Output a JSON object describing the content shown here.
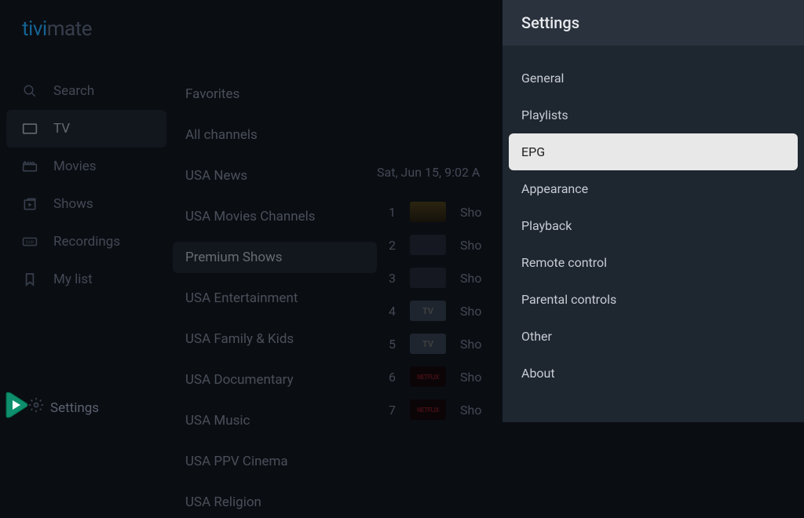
{
  "logo": {
    "brand1": "tivi",
    "brand2": "mate"
  },
  "sidebar": {
    "items": [
      {
        "label": "Search"
      },
      {
        "label": "TV"
      },
      {
        "label": "Movies"
      },
      {
        "label": "Shows"
      },
      {
        "label": "Recordings"
      },
      {
        "label": "My list"
      }
    ],
    "settings_label": "Settings"
  },
  "categories": [
    "Favorites",
    "All channels",
    "USA News",
    "USA Movies Channels",
    "Premium Shows",
    "USA Entertainment",
    "USA Family & Kids",
    "USA Documentary",
    "USA Music",
    "USA PPV Cinema",
    "USA Religion"
  ],
  "schedule": {
    "date": "Sat, Jun 15, 9:02 A",
    "channels": [
      {
        "num": "1",
        "title": "Sho"
      },
      {
        "num": "2",
        "title": "Sho"
      },
      {
        "num": "3",
        "title": "Sho"
      },
      {
        "num": "4",
        "title": "Sho"
      },
      {
        "num": "5",
        "title": "Sho"
      },
      {
        "num": "6",
        "title": "Sho"
      },
      {
        "num": "7",
        "title": "Sho"
      }
    ]
  },
  "settings": {
    "title": "Settings",
    "items": [
      "General",
      "Playlists",
      "EPG",
      "Appearance",
      "Playback",
      "Remote control",
      "Parental controls",
      "Other",
      "About"
    ]
  }
}
